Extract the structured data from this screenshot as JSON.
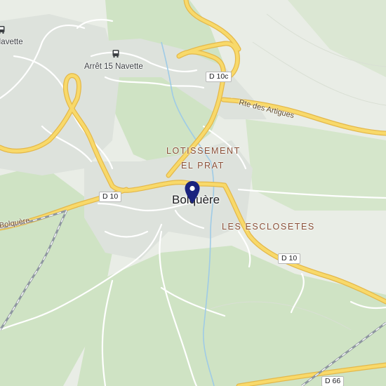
{
  "map": {
    "place": "Bolquère",
    "districts": {
      "lotissement_line1": "LOTISSEMENT",
      "lotissement_line2": "EL PRAT",
      "esclosetes": "LES ESCLOSETES"
    },
    "transit": {
      "stop_main": "Arrêt 15 Navette",
      "stop_edge": "Navette",
      "icon": "bus-icon"
    },
    "roads": {
      "d10c": "D 10c",
      "d10_west": "D 10",
      "d10_east": "D 10",
      "d66": "D 66",
      "artigues": "Rte des Artigues"
    },
    "rail_label": "Bolquère",
    "marker": {
      "icon": "map-pin-icon",
      "color": "#1a237e"
    },
    "colors": {
      "forest": "#cfe3c4",
      "background": "#e9ede6",
      "urban": "#dde2dc",
      "major_road": "#f8d96a",
      "major_road_casing": "#e4b84a",
      "river": "#9fcbe6",
      "rail": "#8e96a0"
    }
  }
}
